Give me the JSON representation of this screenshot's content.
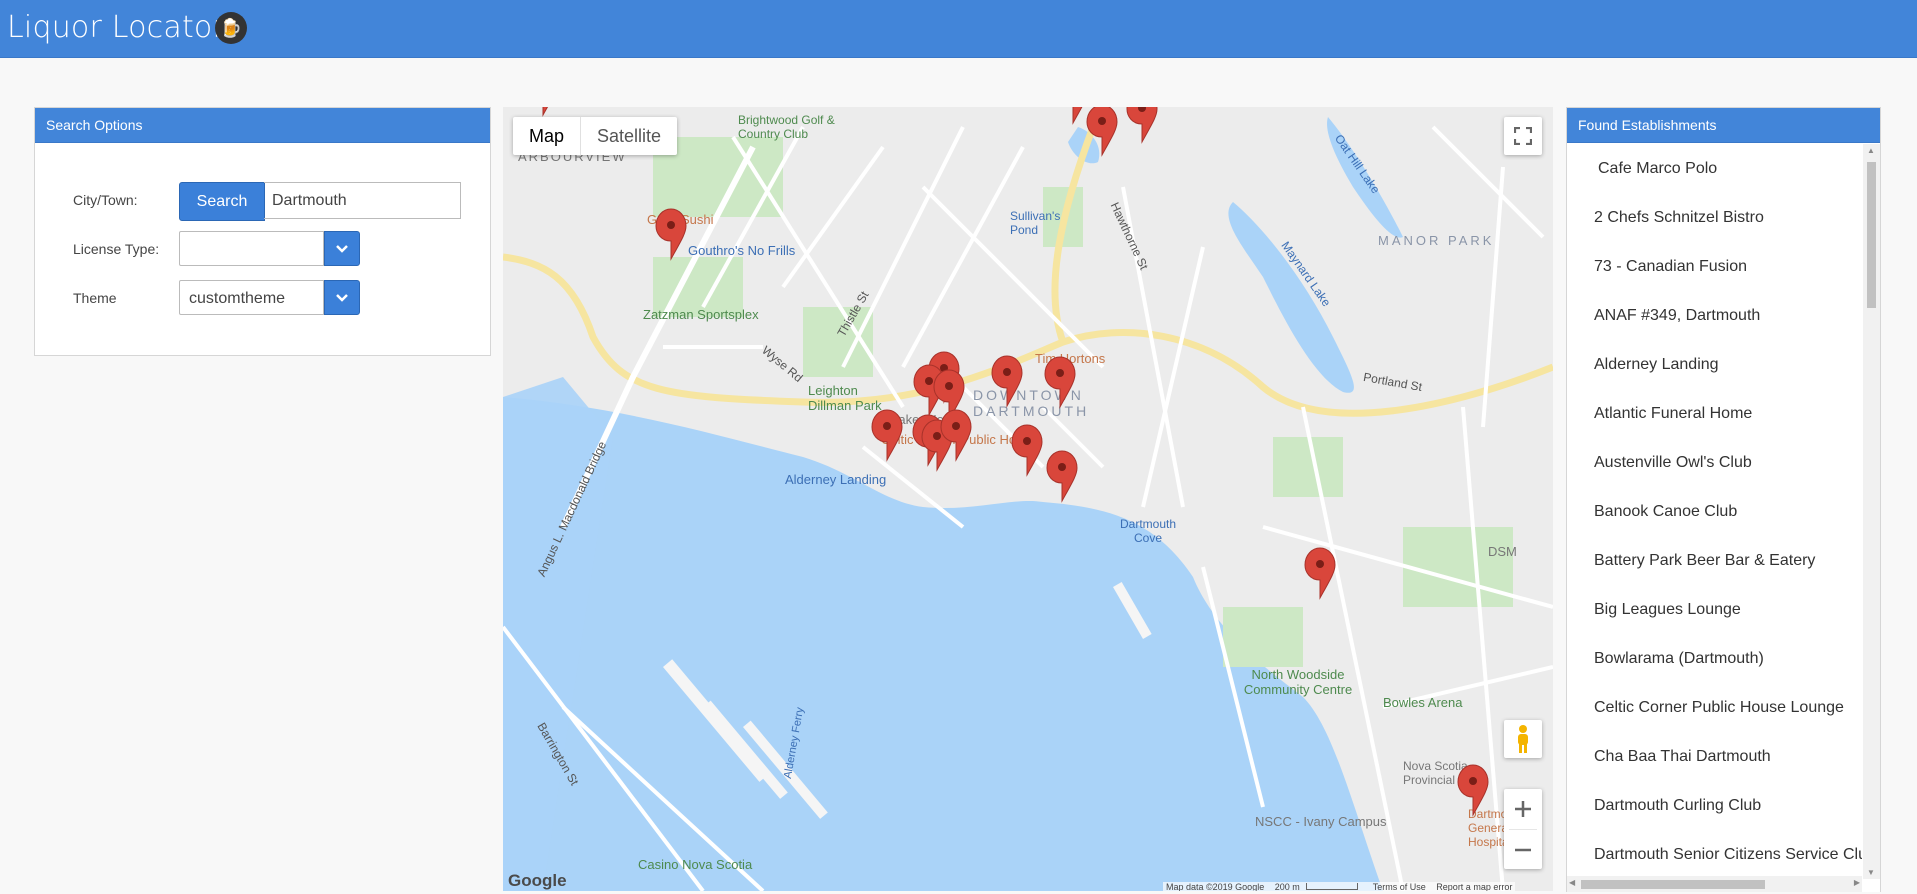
{
  "app": {
    "title": "Liquor Locator",
    "beer_icon": "beer-mug-icon"
  },
  "search": {
    "header": "Search Options",
    "city_label": "City/Town:",
    "search_button": "Search",
    "city_value": "Dartmouth",
    "license_label": "License Type:",
    "license_value": "",
    "theme_label": "Theme",
    "theme_value": "customtheme"
  },
  "map": {
    "type_map": "Map",
    "type_satellite": "Satellite",
    "footer": {
      "logo": "Google",
      "data": "Map data ©2019 Google",
      "scale": "200 m",
      "terms": "Terms of Use",
      "report": "Report a map error"
    },
    "labels": [
      "ARBOURVIEW",
      "Genji Sushi",
      "Gouthro's No Frills",
      "Brightwood Golf & Country Club",
      "Zatzman Sportsplex",
      "Leighton Dillman Park",
      "Quaker House",
      "Celtic Corner Public House",
      "Alderney Landing",
      "Tim Hortons",
      "DOWNTOWN DARTMOUTH",
      "Sullivan's Pond",
      "Maynard Lake",
      "Oat Hill Lake",
      "MANOR PARK",
      "Dartmouth Cove",
      "DSM",
      "North Woodside Community Centre",
      "Bowles Arena",
      "Nova Scotia Provincial Court",
      "NSCC - Ivany Campus",
      "Dartmouth General Hospital",
      "Casino Nova Scotia",
      "Portland St",
      "Wyse Rd",
      "Thistle St",
      "Hawthorne St",
      "Alderney Ferry",
      "Angus L. Macdonald Bridge",
      "Barrington St"
    ]
  },
  "list": {
    "header": "Found Establishments",
    "items": [
      "Cafe Marco Polo",
      "2 Chefs Schnitzel Bistro",
      "73 - Canadian Fusion",
      "ANAF #349, Dartmouth",
      "Alderney Landing",
      "Atlantic Funeral Home",
      "Austenville Owl's Club",
      "Banook Canoe Club",
      "Battery Park Beer Bar & Eatery",
      "Big Leagues Lounge",
      "Bowlarama (Dartmouth)",
      "Celtic Corner Public House Lounge",
      "Cha Baa Thai Dartmouth",
      "Dartmouth Curling Club",
      "Dartmouth Senior Citizens Service Club"
    ]
  },
  "colors": {
    "accent": "#4285d9",
    "water": "#aad3f8",
    "pin": "#d9463b"
  }
}
